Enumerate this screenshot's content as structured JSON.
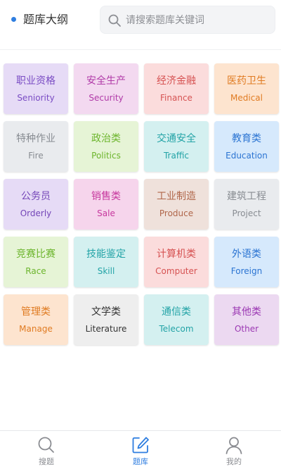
{
  "header": {
    "title": "题库大纲",
    "search_placeholder": "请搜索题库关键词"
  },
  "categories": [
    {
      "cn": "职业资格",
      "en": "Seniority",
      "bg": "#e6dbf6",
      "fg": "#7a4cc4"
    },
    {
      "cn": "安全生产",
      "en": "Security",
      "bg": "#f3d9f0",
      "fg": "#b03aa8"
    },
    {
      "cn": "经济金融",
      "en": "Finance",
      "bg": "#fbdcdc",
      "fg": "#d65252"
    },
    {
      "cn": "医药卫生",
      "en": "Medical",
      "bg": "#fde4cf",
      "fg": "#e07b22"
    },
    {
      "cn": "特种作业",
      "en": "Fire",
      "bg": "#e9ebee",
      "fg": "#888c92"
    },
    {
      "cn": "政治类",
      "en": "Politics",
      "bg": "#e6f4d6",
      "fg": "#6cb52c"
    },
    {
      "cn": "交通安全",
      "en": "Traffic",
      "bg": "#d4f0f0",
      "fg": "#22a3a6"
    },
    {
      "cn": "教育类",
      "en": "Education",
      "bg": "#d6e9fc",
      "fg": "#2b74d2"
    },
    {
      "cn": "公务员",
      "en": "Orderly",
      "bg": "#e6dbf6",
      "fg": "#7446b8"
    },
    {
      "cn": "销售类",
      "en": "Sale",
      "bg": "#f6d5ec",
      "fg": "#c7389e"
    },
    {
      "cn": "工业制造",
      "en": "Produce",
      "bg": "#efe1db",
      "fg": "#b0664a"
    },
    {
      "cn": "建筑工程",
      "en": "Project",
      "bg": "#e9ebee",
      "fg": "#888c92"
    },
    {
      "cn": "竞赛比赛",
      "en": "Race",
      "bg": "#e6f4d6",
      "fg": "#6cb52c"
    },
    {
      "cn": "技能鉴定",
      "en": "Skill",
      "bg": "#d4f0f0",
      "fg": "#22a3a6"
    },
    {
      "cn": "计算机类",
      "en": "Computer",
      "bg": "#fbdcdc",
      "fg": "#d65252"
    },
    {
      "cn": "外语类",
      "en": "Foreign",
      "bg": "#d6e9fc",
      "fg": "#2b74d2"
    },
    {
      "cn": "管理类",
      "en": "Manage",
      "bg": "#fde4cf",
      "fg": "#e07b22"
    },
    {
      "cn": "文学类",
      "en": "Literature",
      "bg": "#eeeeee",
      "fg": "#333333"
    },
    {
      "cn": "通信类",
      "en": "Telecom",
      "bg": "#d4f0f0",
      "fg": "#22a3a6"
    },
    {
      "cn": "其他类",
      "en": "Other",
      "bg": "#ecd9f1",
      "fg": "#9b38b3"
    }
  ],
  "tabbar": {
    "tabs": [
      {
        "label": "搜题",
        "icon": "search-icon",
        "active": false
      },
      {
        "label": "题库",
        "icon": "edit-icon",
        "active": true
      },
      {
        "label": "我的",
        "icon": "user-icon",
        "active": false
      }
    ],
    "active_color": "#2f7ee0",
    "inactive_color": "#8a8c91"
  }
}
